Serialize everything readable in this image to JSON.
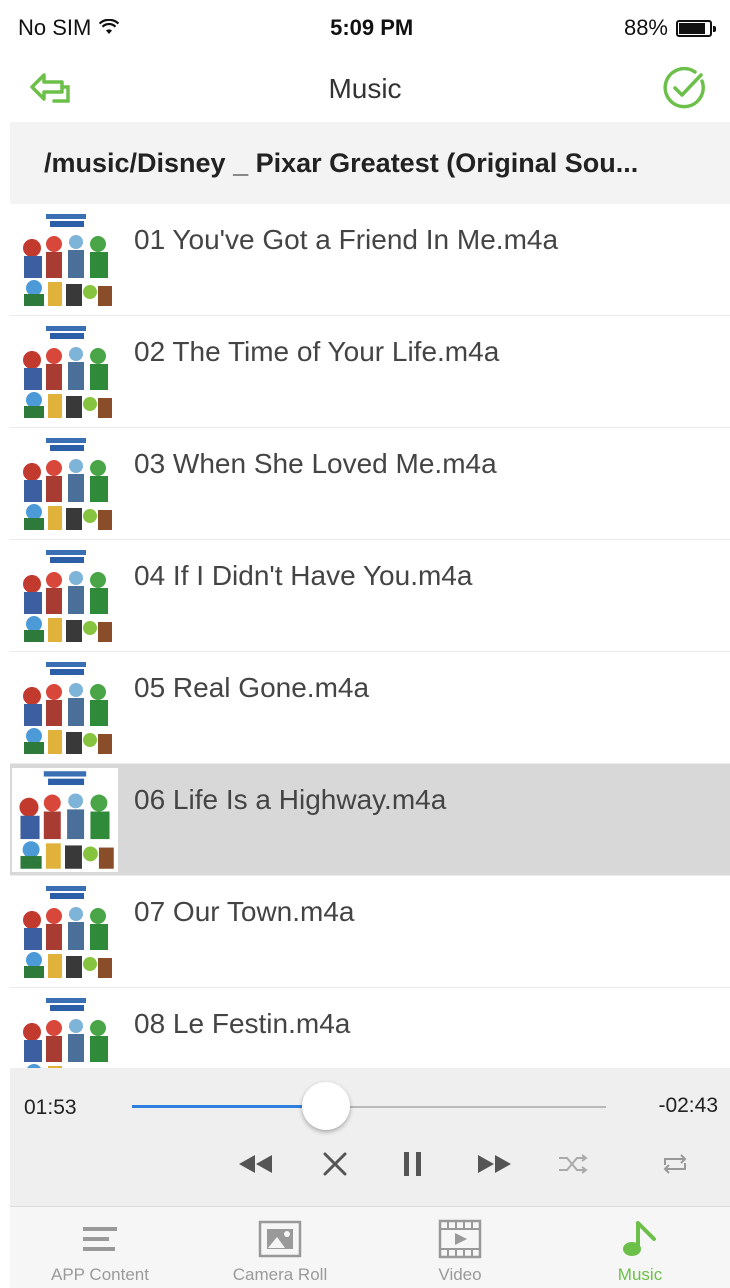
{
  "status_bar": {
    "carrier": "No SIM",
    "time": "5:09 PM",
    "battery": "88%",
    "battery_level": 0.88,
    "icons": [
      "wifi-icon",
      "battery-icon"
    ]
  },
  "nav": {
    "title": "Music",
    "back_icon": "back-arrow-icon",
    "done_icon": "checkmark-circle-icon"
  },
  "path": "/music/Disney _ Pixar Greatest (Original Sou...",
  "tracks": [
    {
      "title": "01 You've Got a Friend In Me.m4a",
      "selected": false
    },
    {
      "title": "02 The Time of Your Life.m4a",
      "selected": false
    },
    {
      "title": "03 When She Loved Me.m4a",
      "selected": false
    },
    {
      "title": "04 If I Didn't Have You.m4a",
      "selected": false
    },
    {
      "title": "05 Real Gone.m4a",
      "selected": false
    },
    {
      "title": "06 Life Is a Highway.m4a",
      "selected": true
    },
    {
      "title": "07 Our Town.m4a",
      "selected": false
    },
    {
      "title": "08 Le Festin.m4a",
      "selected": false
    }
  ],
  "player": {
    "elapsed": "01:53",
    "remaining": "-02:43",
    "progress": 0.41,
    "controls": [
      "rewind-icon",
      "close-icon",
      "pause-icon",
      "fast-forward-icon",
      "shuffle-icon",
      "repeat-icon"
    ]
  },
  "tabs": [
    {
      "label": "APP Content",
      "icon": "list-icon",
      "active": false
    },
    {
      "label": "Camera Roll",
      "icon": "photo-icon",
      "active": false
    },
    {
      "label": "Video",
      "icon": "film-icon",
      "active": false
    },
    {
      "label": "Music",
      "icon": "music-note-icon",
      "active": true
    }
  ],
  "colors": {
    "accent_green": "#6cc04a",
    "progress_blue": "#2f7fe0",
    "selected_row": "#d8d8d8"
  }
}
